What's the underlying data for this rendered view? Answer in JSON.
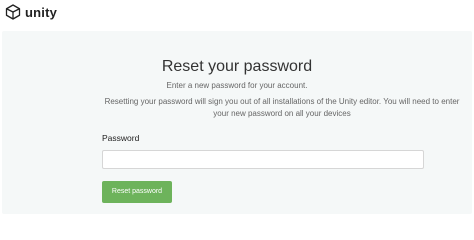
{
  "header": {
    "logo_text": "unity",
    "logo_icon": "unity-cube-icon"
  },
  "main": {
    "title": "Reset your password",
    "subtitle": "Enter a new password for your account.",
    "warning": "Resetting your password will sign you out of all installations of the Unity editor. You will need to enter your new password on all your devices",
    "password_label": "Password",
    "password_value": "",
    "password_placeholder": "",
    "reset_button_label": "Reset password"
  },
  "colors": {
    "background": "#f5f8f8",
    "button": "#6db35b",
    "button_text": "#ffffff",
    "title_text": "#333333",
    "body_text": "#666666"
  }
}
